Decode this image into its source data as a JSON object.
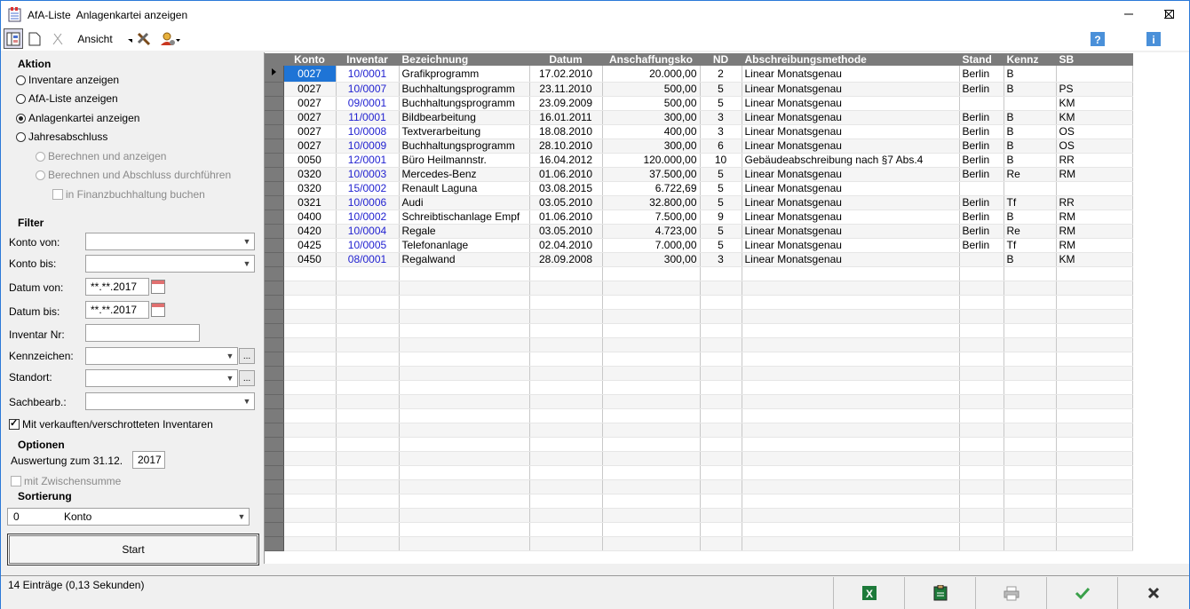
{
  "window": {
    "app_name": "AfA-Liste",
    "title": "Anlagenkartei anzeigen"
  },
  "toolbar": {
    "view_label": "Ansicht"
  },
  "aktion": {
    "heading": "Aktion",
    "options": [
      "Inventare anzeigen",
      "AfA-Liste anzeigen",
      "Anlagenkartei anzeigen",
      "Jahresabschluss"
    ],
    "selected_index": 2,
    "sub_options": [
      "Berechnen und anzeigen",
      "Berechnen und Abschluss durchführen"
    ],
    "fibu_label": "in Finanzbuchhaltung buchen"
  },
  "filter": {
    "heading": "Filter",
    "konto_von_label": "Konto von:",
    "konto_bis_label": "Konto bis:",
    "datum_von_label": "Datum von:",
    "datum_von_value": "**.**.2017",
    "datum_bis_label": "Datum bis:",
    "datum_bis_value": "**.**.2017",
    "inventar_label": "Inventar Nr:",
    "kennzeichen_label": "Kennzeichen:",
    "standort_label": "Standort:",
    "sachbearb_label": "Sachbearb.:",
    "verkauft_label": "Mit verkauften/verschrotteten Inventaren",
    "verkauft_checked": true
  },
  "optionen": {
    "heading": "Optionen",
    "auswertung_label": "Auswertung zum 31.12.",
    "auswertung_value": "2017",
    "zwischensumme_label": "mit Zwischensumme"
  },
  "sortierung": {
    "heading": "Sortierung",
    "value_num": "0",
    "value_label": "Konto"
  },
  "start_label": "Start",
  "grid": {
    "columns": [
      "Konto",
      "Inventar",
      "Bezeichnung",
      "Datum",
      "Anschaffungsko",
      "ND",
      "Abschreibungsmethode",
      "Stand",
      "Kennz",
      "SB"
    ],
    "rows": [
      [
        "0027",
        "10/0001",
        "Grafikprogramm",
        "17.02.2010",
        "20.000,00",
        "2",
        "Linear Monatsgenau",
        "Berlin",
        "B",
        ""
      ],
      [
        "0027",
        "10/0007",
        "Buchhaltungsprogramm",
        "23.11.2010",
        "500,00",
        "5",
        "Linear Monatsgenau",
        "Berlin",
        "B",
        "PS"
      ],
      [
        "0027",
        "09/0001",
        "Buchhaltungsprogramm",
        "23.09.2009",
        "500,00",
        "5",
        "Linear Monatsgenau",
        "",
        "",
        "KM"
      ],
      [
        "0027",
        "11/0001",
        "Bildbearbeitung",
        "16.01.2011",
        "300,00",
        "3",
        "Linear Monatsgenau",
        "Berlin",
        "B",
        "KM"
      ],
      [
        "0027",
        "10/0008",
        "Textverarbeitung",
        "18.08.2010",
        "400,00",
        "3",
        "Linear Monatsgenau",
        "Berlin",
        "B",
        "OS"
      ],
      [
        "0027",
        "10/0009",
        "Buchhaltungsprogramm",
        "28.10.2010",
        "300,00",
        "6",
        "Linear Monatsgenau",
        "Berlin",
        "B",
        "OS"
      ],
      [
        "0050",
        "12/0001",
        "Büro Heilmannstr.",
        "16.04.2012",
        "120.000,00",
        "10",
        "Gebäudeabschreibung nach §7 Abs.4",
        "Berlin",
        "B",
        "RR"
      ],
      [
        "0320",
        "10/0003",
        "Mercedes-Benz",
        "01.06.2010",
        "37.500,00",
        "5",
        "Linear Monatsgenau",
        "Berlin",
        "Re",
        "RM"
      ],
      [
        "0320",
        "15/0002",
        "Renault Laguna",
        "03.08.2015",
        "6.722,69",
        "5",
        "Linear Monatsgenau",
        "",
        "",
        ""
      ],
      [
        "0321",
        "10/0006",
        "Audi",
        "03.05.2010",
        "32.800,00",
        "5",
        "Linear Monatsgenau",
        "Berlin",
        "Tf",
        "RR"
      ],
      [
        "0400",
        "10/0002",
        "Schreibtischanlage Empf",
        "01.06.2010",
        "7.500,00",
        "9",
        "Linear Monatsgenau",
        "Berlin",
        "B",
        "RM"
      ],
      [
        "0420",
        "10/0004",
        "Regale",
        "03.05.2010",
        "4.723,00",
        "5",
        "Linear Monatsgenau",
        "Berlin",
        "Re",
        "RM"
      ],
      [
        "0425",
        "10/0005",
        "Telefonanlage",
        "02.04.2010",
        "7.000,00",
        "5",
        "Linear Monatsgenau",
        "Berlin",
        "Tf",
        "RM"
      ],
      [
        "0450",
        "08/0001",
        "Regalwand",
        "28.09.2008",
        "300,00",
        "3",
        "Linear Monatsgenau",
        "",
        "B",
        "KM"
      ]
    ]
  },
  "status": {
    "text": "14 Einträge (0,13 Sekunden)"
  },
  "colors": {
    "header_bg": "#7b7b7b",
    "selection": "#1e74d6",
    "link": "#1f1fd0",
    "excel_green": "#1d7a3a"
  }
}
